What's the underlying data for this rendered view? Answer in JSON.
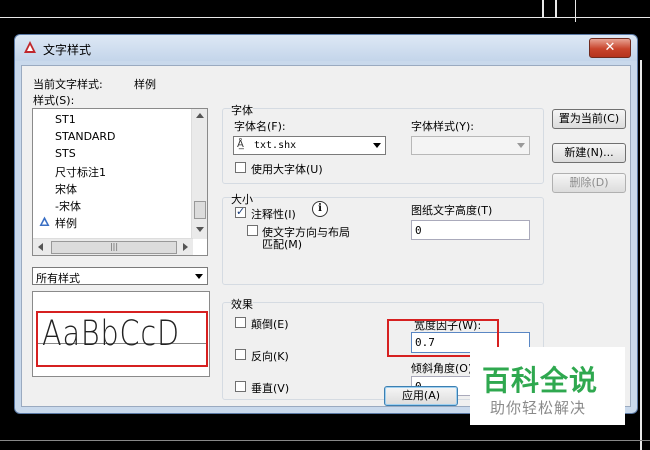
{
  "window": {
    "title": "文字样式",
    "close_symbol": "✕"
  },
  "current_style": {
    "label": "当前文字样式:",
    "value": "样例"
  },
  "styles": {
    "label": "样式(S):",
    "items": [
      "ST1",
      "STANDARD",
      "STS",
      "尺寸标注1",
      "宋体",
      "-宋体",
      "样例"
    ],
    "filter_value": "所有样式"
  },
  "preview": {
    "text": "AaBbCcD"
  },
  "font": {
    "group_label": "字体",
    "name_label": "字体名(F):",
    "name_value": "txt.shx",
    "style_label": "字体样式(Y):",
    "style_value": "",
    "bigfont_label": "使用大字体(U)"
  },
  "size": {
    "group_label": "大小",
    "annotative_label": "注释性(I)",
    "match_label": "使文字方向与布局",
    "match_label2": "匹配(M)",
    "height_label": "图纸文字高度(T)",
    "height_value": "0"
  },
  "effects": {
    "group_label": "效果",
    "upside_down_label": "颠倒(E)",
    "backwards_label": "反向(K)",
    "vertical_label": "垂直(V)",
    "width_factor_label": "宽度因子(W):",
    "width_factor_value": "0.7",
    "oblique_label": "倾斜角度(O):",
    "oblique_value": "0"
  },
  "buttons": {
    "set_current": "置为当前(C)",
    "new": "新建(N)...",
    "delete": "删除(D)",
    "apply": "应用(A)"
  },
  "watermark": {
    "title": "百科全说",
    "subtitle": "助你轻松解决"
  },
  "colors": {
    "accent_red": "#d62020",
    "watermark_green": "#2fa84f",
    "title_bar": "#c9d9ec"
  }
}
